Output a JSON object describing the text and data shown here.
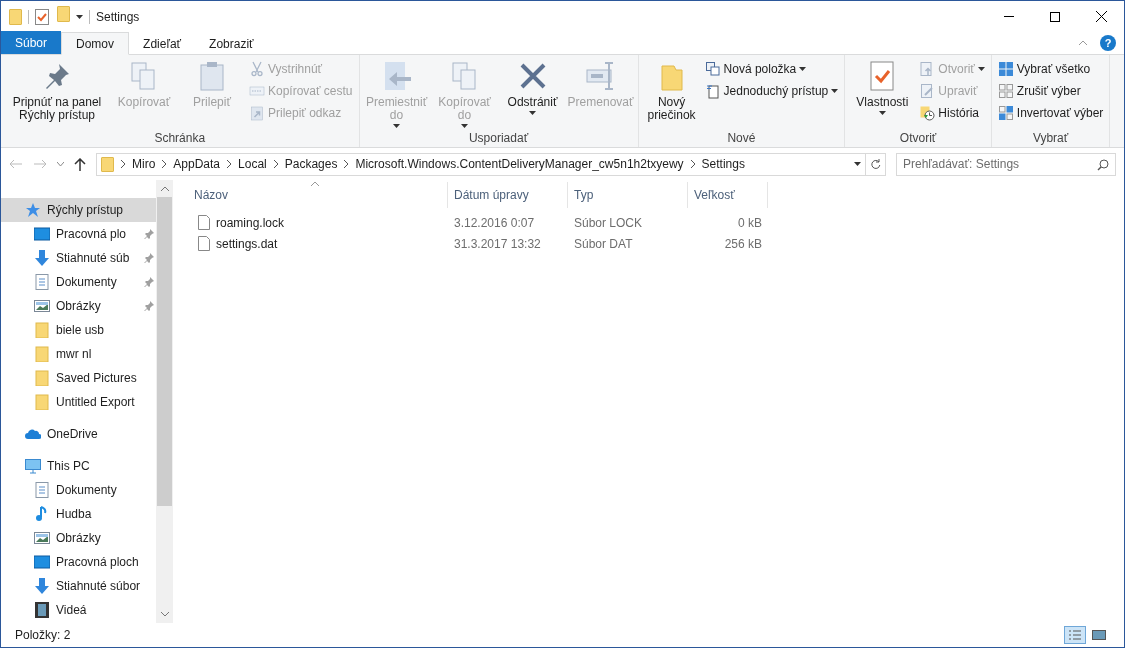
{
  "window": {
    "title": "Settings"
  },
  "ribbon_tabs": [
    {
      "label": "Súbor",
      "kind": "file",
      "selected": false
    },
    {
      "label": "Domov",
      "kind": "tab",
      "selected": true
    },
    {
      "label": "Zdieľať",
      "kind": "tab",
      "selected": false
    },
    {
      "label": "Zobraziť",
      "kind": "tab",
      "selected": false
    }
  ],
  "ribbon_groups": [
    {
      "label": "Schránka",
      "items": [
        {
          "kind": "large",
          "label": "Pripnúť na panel Rýchly prístup",
          "disabled": false,
          "dropdown": false
        },
        {
          "kind": "large",
          "label": "Kopírovať",
          "disabled": true,
          "dropdown": false
        },
        {
          "kind": "large",
          "label": "Prilepiť",
          "disabled": true,
          "dropdown": false
        },
        {
          "kind": "stack",
          "items": [
            {
              "label": "Vystrihnúť",
              "disabled": true,
              "dropdown": false
            },
            {
              "label": "Kopírovať cestu",
              "disabled": true,
              "dropdown": false
            },
            {
              "label": "Prilepiť odkaz",
              "disabled": true,
              "dropdown": false
            }
          ]
        }
      ]
    },
    {
      "label": "Usporiadať",
      "items": [
        {
          "kind": "large",
          "label": "Premiestniť do",
          "disabled": true,
          "dropdown": true
        },
        {
          "kind": "large",
          "label": "Kopírovať do",
          "disabled": true,
          "dropdown": true
        },
        {
          "kind": "large",
          "label": "Odstrániť",
          "disabled": false,
          "dropdown": true
        },
        {
          "kind": "large",
          "label": "Premenovať",
          "disabled": true,
          "dropdown": false
        }
      ]
    },
    {
      "label": "Nové",
      "items": [
        {
          "kind": "large",
          "label": "Nový priečinok",
          "disabled": false,
          "dropdown": false
        },
        {
          "kind": "stack",
          "items": [
            {
              "label": "Nová položka",
              "disabled": false,
              "dropdown": true
            },
            {
              "label": "Jednoduchý prístup",
              "disabled": false,
              "dropdown": true
            }
          ]
        }
      ]
    },
    {
      "label": "Otvoriť",
      "items": [
        {
          "kind": "large",
          "label": "Vlastnosti",
          "disabled": false,
          "dropdown": true
        },
        {
          "kind": "stack",
          "items": [
            {
              "label": "Otvoriť",
              "disabled": true,
              "dropdown": true
            },
            {
              "label": "Upraviť",
              "disabled": true,
              "dropdown": false
            },
            {
              "label": "História",
              "disabled": false,
              "dropdown": false
            }
          ]
        }
      ]
    },
    {
      "label": "Vybrať",
      "items": [
        {
          "kind": "stack",
          "items": [
            {
              "label": "Vybrať všetko",
              "disabled": false,
              "dropdown": false
            },
            {
              "label": "Zrušiť výber",
              "disabled": false,
              "dropdown": false
            },
            {
              "label": "Invertovať výber",
              "disabled": false,
              "dropdown": false
            }
          ]
        }
      ]
    }
  ],
  "help_button": {
    "label": "?"
  },
  "address_bar": {
    "segments": [
      "Miro",
      "AppData",
      "Local",
      "Packages",
      "Microsoft.Windows.ContentDeliveryManager_cw5n1h2txyewy",
      "Settings"
    ]
  },
  "search": {
    "placeholder": "Prehľadávať: Settings"
  },
  "sidebar": {
    "items": [
      {
        "label": "Rýchly prístup",
        "kind": "star",
        "selected": true,
        "children": [
          {
            "label": "Pracovná plo",
            "kind": "desktop",
            "pinned": true,
            "selected": false
          },
          {
            "label": "Stiahnuté súb",
            "kind": "download",
            "pinned": true,
            "selected": false
          },
          {
            "label": "Dokumenty",
            "kind": "document",
            "pinned": true,
            "selected": false
          },
          {
            "label": "Obrázky",
            "kind": "pictures",
            "pinned": true,
            "selected": false
          },
          {
            "label": "biele usb",
            "kind": "folder",
            "pinned": false,
            "selected": false
          },
          {
            "label": "mwr nl",
            "kind": "folder",
            "pinned": false,
            "selected": false
          },
          {
            "label": "Saved Pictures",
            "kind": "folder",
            "pinned": false,
            "selected": false
          },
          {
            "label": "Untitled Export",
            "kind": "folder",
            "pinned": false,
            "selected": false
          }
        ]
      },
      {
        "label": "OneDrive",
        "kind": "cloud",
        "selected": false
      },
      {
        "label": "This PC",
        "kind": "pc",
        "selected": false,
        "children": [
          {
            "label": "Dokumenty",
            "kind": "document",
            "pinned": false,
            "selected": false
          },
          {
            "label": "Hudba",
            "kind": "music",
            "pinned": false,
            "selected": false
          },
          {
            "label": "Obrázky",
            "kind": "pictures",
            "pinned": false,
            "selected": false
          },
          {
            "label": "Pracovná ploch",
            "kind": "desktop",
            "pinned": false,
            "selected": false
          },
          {
            "label": "Stiahnuté súbor",
            "kind": "download",
            "pinned": false,
            "selected": false
          },
          {
            "label": "Videá",
            "kind": "video",
            "pinned": false,
            "selected": false
          }
        ]
      }
    ]
  },
  "table": {
    "columns": [
      "Názov",
      "Dátum úpravy",
      "Typ",
      "Veľkosť"
    ],
    "rows": [
      {
        "name": "roaming.lock",
        "date": "3.12.2016 0:07",
        "type": "Súbor LOCK",
        "size": "0 kB"
      },
      {
        "name": "settings.dat",
        "date": "31.3.2017 13:32",
        "type": "Súbor DAT",
        "size": "256 kB"
      }
    ]
  },
  "status_bar": {
    "text": "Položky: 2"
  }
}
